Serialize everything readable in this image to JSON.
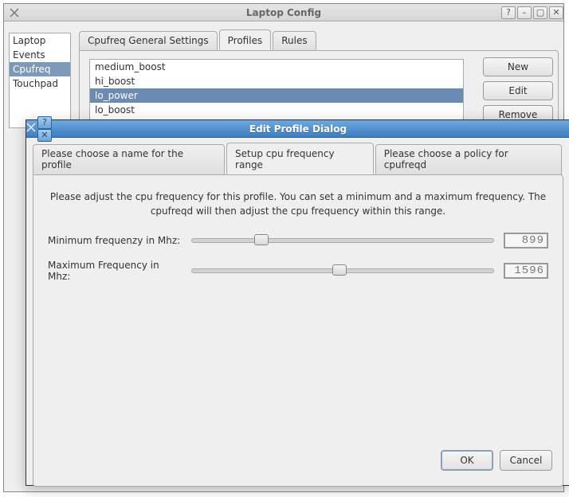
{
  "main": {
    "title": "Laptop Config",
    "sidebar": {
      "items": [
        {
          "label": "Laptop"
        },
        {
          "label": "Events"
        },
        {
          "label": "Cpufreq",
          "selected": true
        },
        {
          "label": "Touchpad"
        }
      ]
    },
    "tabs": [
      {
        "label": "Cpufreq General Settings"
      },
      {
        "label": "Profiles",
        "active": true
      },
      {
        "label": "Rules"
      }
    ],
    "profiles_tab": {
      "list": [
        {
          "label": "medium_boost"
        },
        {
          "label": "hi_boost"
        },
        {
          "label": "lo_power",
          "selected": true
        },
        {
          "label": "lo_boost"
        }
      ],
      "buttons": {
        "new": "New",
        "edit": "Edit",
        "remove": "Remove"
      }
    }
  },
  "dialog": {
    "title": "Edit Profile Dialog",
    "tabs": [
      {
        "label": "Please choose a name for the profile"
      },
      {
        "label": "Setup cpu frequency range",
        "active": true
      },
      {
        "label": "Please choose a policy for cpufreqd"
      }
    ],
    "desc": "Please adjust the cpu frequency for this profile. You can set a minimum and a maximum frequency. The cpufreqd will then adjust the cpu frequency within this range.",
    "min": {
      "label": "Minimum frequenzy in Mhz:",
      "value": "899",
      "percent": 23
    },
    "max": {
      "label": "Maximum Frequency in Mhz:",
      "value": "1596",
      "percent": 49
    },
    "ok": "OK",
    "cancel": "Cancel"
  }
}
